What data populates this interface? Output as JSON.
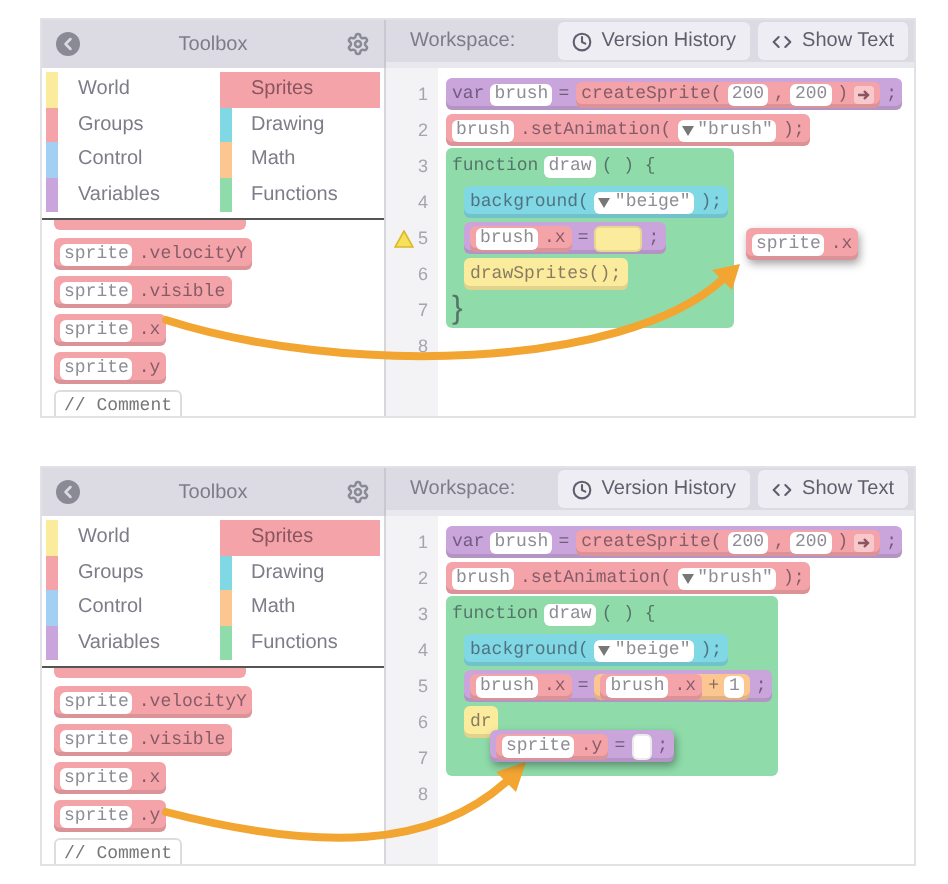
{
  "panels": [
    {
      "toolbox": {
        "title": "Toolbox",
        "categories": [
          {
            "label": "World",
            "color": "#fbeb9c",
            "selected": false
          },
          {
            "label": "Sprites",
            "color": "#f4a4a9",
            "selected": true
          },
          {
            "label": "Groups",
            "color": "#f4a4a9",
            "selected": false
          },
          {
            "label": "Drawing",
            "color": "#7fd8e4",
            "selected": false
          },
          {
            "label": "Control",
            "color": "#a3cff2",
            "selected": false
          },
          {
            "label": "Math",
            "color": "#fbc690",
            "selected": false
          },
          {
            "label": "Variables",
            "color": "#c9a5dc",
            "selected": false
          },
          {
            "label": "Functions",
            "color": "#8fdcaa",
            "selected": false
          }
        ],
        "palette": [
          {
            "kind": "block",
            "color": "#f4a4a9",
            "parts": [
              {
                "kind": "slot",
                "text": "sprite"
              },
              {
                "kind": "text",
                "text": ".velocityY"
              }
            ]
          },
          {
            "kind": "block",
            "color": "#f4a4a9",
            "parts": [
              {
                "kind": "slot",
                "text": "sprite"
              },
              {
                "kind": "text",
                "text": ".visible"
              }
            ]
          },
          {
            "kind": "block",
            "color": "#f4a4a9",
            "parts": [
              {
                "kind": "slot",
                "text": "sprite"
              },
              {
                "kind": "text",
                "text": ".x"
              }
            ]
          },
          {
            "kind": "block",
            "color": "#f4a4a9",
            "parts": [
              {
                "kind": "slot",
                "text": "sprite"
              },
              {
                "kind": "text",
                "text": ".y"
              }
            ]
          },
          {
            "kind": "comment",
            "text": "// Comment"
          }
        ]
      },
      "workspace": {
        "title": "Workspace:",
        "buttons": [
          {
            "label": "Version History",
            "kind": "history"
          },
          {
            "label": "Show Text",
            "kind": "code"
          }
        ],
        "line_numbers": [
          {
            "label": "1",
            "warning": false
          },
          {
            "label": "2",
            "warning": false
          },
          {
            "label": "3",
            "warning": false
          },
          {
            "label": "4",
            "warning": false
          },
          {
            "label": "5",
            "warning": true
          },
          {
            "label": "6",
            "warning": false
          },
          {
            "label": "7",
            "warning": false
          },
          {
            "label": "8",
            "warning": false
          }
        ],
        "program": [
          {
            "kind": "block",
            "color": "#c9a5dc",
            "parts": [
              {
                "kind": "text",
                "text": "var"
              },
              {
                "kind": "slot",
                "text": "brush"
              },
              {
                "kind": "text",
                "text": "="
              },
              {
                "kind": "block",
                "color": "#f4a4a9",
                "parts": [
                  {
                    "kind": "text",
                    "text": "createSprite("
                  },
                  {
                    "kind": "slot",
                    "text": "200"
                  },
                  {
                    "kind": "text",
                    "text": ","
                  },
                  {
                    "kind": "slot",
                    "text": "200"
                  },
                  {
                    "kind": "text",
                    "text": ")"
                  },
                  {
                    "kind": "expand"
                  }
                ]
              },
              {
                "kind": "text",
                "text": ";"
              }
            ]
          },
          {
            "kind": "block",
            "color": "#f4a4a9",
            "parts": [
              {
                "kind": "slot",
                "text": "brush"
              },
              {
                "kind": "text",
                "text": ".setAnimation("
              },
              {
                "kind": "dropdown",
                "text": "\"brush\""
              },
              {
                "kind": "text",
                "text": ");"
              }
            ]
          },
          {
            "kind": "function",
            "color": "#8fdcaa",
            "parts": [
              {
                "kind": "text",
                "text": "function"
              },
              {
                "kind": "slot",
                "text": "draw"
              },
              {
                "kind": "text",
                "text": "( ) {"
              }
            ],
            "end": "}",
            "children": [
              {
                "kind": "block",
                "color": "#7fd8e4",
                "parts": [
                  {
                    "kind": "text",
                    "text": "background("
                  },
                  {
                    "kind": "dropdown",
                    "text": "\"beige\""
                  },
                  {
                    "kind": "text",
                    "text": ");"
                  }
                ]
              },
              {
                "kind": "block",
                "color": "#c9a5dc",
                "parts": [
                  {
                    "kind": "block",
                    "color": "#f4a4a9",
                    "parts": [
                      {
                        "kind": "slot",
                        "text": "brush"
                      },
                      {
                        "kind": "text",
                        "text": ".x"
                      }
                    ]
                  },
                  {
                    "kind": "text",
                    "text": "="
                  },
                  {
                    "kind": "hole",
                    "color": "#fbeb9c"
                  },
                  {
                    "kind": "text",
                    "text": ";"
                  }
                ]
              },
              {
                "kind": "block",
                "color": "#fbeb9c",
                "parts": [
                  {
                    "kind": "text",
                    "text": "drawSprites();"
                  }
                ]
              }
            ]
          }
        ],
        "dragged": {
          "kind": "block",
          "color": "#f4a4a9",
          "parts": [
            {
              "kind": "slot",
              "text": "sprite"
            },
            {
              "kind": "text",
              "text": ".x"
            }
          ]
        }
      }
    },
    {
      "toolbox": {
        "title": "Toolbox",
        "categories": [
          {
            "label": "World",
            "color": "#fbeb9c",
            "selected": false
          },
          {
            "label": "Sprites",
            "color": "#f4a4a9",
            "selected": true
          },
          {
            "label": "Groups",
            "color": "#f4a4a9",
            "selected": false
          },
          {
            "label": "Drawing",
            "color": "#7fd8e4",
            "selected": false
          },
          {
            "label": "Control",
            "color": "#a3cff2",
            "selected": false
          },
          {
            "label": "Math",
            "color": "#fbc690",
            "selected": false
          },
          {
            "label": "Variables",
            "color": "#c9a5dc",
            "selected": false
          },
          {
            "label": "Functions",
            "color": "#8fdcaa",
            "selected": false
          }
        ],
        "palette": [
          {
            "kind": "block",
            "color": "#f4a4a9",
            "parts": [
              {
                "kind": "slot",
                "text": "sprite"
              },
              {
                "kind": "text",
                "text": ".velocityY"
              }
            ]
          },
          {
            "kind": "block",
            "color": "#f4a4a9",
            "parts": [
              {
                "kind": "slot",
                "text": "sprite"
              },
              {
                "kind": "text",
                "text": ".visible"
              }
            ]
          },
          {
            "kind": "block",
            "color": "#f4a4a9",
            "parts": [
              {
                "kind": "slot",
                "text": "sprite"
              },
              {
                "kind": "text",
                "text": ".x"
              }
            ]
          },
          {
            "kind": "block",
            "color": "#f4a4a9",
            "parts": [
              {
                "kind": "slot",
                "text": "sprite"
              },
              {
                "kind": "text",
                "text": ".y"
              }
            ]
          },
          {
            "kind": "comment",
            "text": "// Comment"
          }
        ]
      },
      "workspace": {
        "title": "Workspace:",
        "buttons": [
          {
            "label": "Version History",
            "kind": "history"
          },
          {
            "label": "Show Text",
            "kind": "code"
          }
        ],
        "line_numbers": [
          {
            "label": "1",
            "warning": false
          },
          {
            "label": "2",
            "warning": false
          },
          {
            "label": "3",
            "warning": false
          },
          {
            "label": "4",
            "warning": false
          },
          {
            "label": "5",
            "warning": false
          },
          {
            "label": "6",
            "warning": false
          },
          {
            "label": "7",
            "warning": false
          },
          {
            "label": "8",
            "warning": false
          }
        ],
        "program": [
          {
            "kind": "block",
            "color": "#c9a5dc",
            "parts": [
              {
                "kind": "text",
                "text": "var"
              },
              {
                "kind": "slot",
                "text": "brush"
              },
              {
                "kind": "text",
                "text": "="
              },
              {
                "kind": "block",
                "color": "#f4a4a9",
                "parts": [
                  {
                    "kind": "text",
                    "text": "createSprite("
                  },
                  {
                    "kind": "slot",
                    "text": "200"
                  },
                  {
                    "kind": "text",
                    "text": ","
                  },
                  {
                    "kind": "slot",
                    "text": "200"
                  },
                  {
                    "kind": "text",
                    "text": ")"
                  },
                  {
                    "kind": "expand"
                  }
                ]
              },
              {
                "kind": "text",
                "text": ";"
              }
            ]
          },
          {
            "kind": "block",
            "color": "#f4a4a9",
            "parts": [
              {
                "kind": "slot",
                "text": "brush"
              },
              {
                "kind": "text",
                "text": ".setAnimation("
              },
              {
                "kind": "dropdown",
                "text": "\"brush\""
              },
              {
                "kind": "text",
                "text": ");"
              }
            ]
          },
          {
            "kind": "function",
            "color": "#8fdcaa",
            "parts": [
              {
                "kind": "text",
                "text": "function"
              },
              {
                "kind": "slot",
                "text": "draw"
              },
              {
                "kind": "text",
                "text": "( ) {"
              }
            ],
            "children": [
              {
                "kind": "block",
                "color": "#7fd8e4",
                "parts": [
                  {
                    "kind": "text",
                    "text": "background("
                  },
                  {
                    "kind": "dropdown",
                    "text": "\"beige\""
                  },
                  {
                    "kind": "text",
                    "text": ");"
                  }
                ]
              },
              {
                "kind": "block",
                "color": "#c9a5dc",
                "parts": [
                  {
                    "kind": "block",
                    "color": "#f4a4a9",
                    "parts": [
                      {
                        "kind": "slot",
                        "text": "brush"
                      },
                      {
                        "kind": "text",
                        "text": ".x"
                      }
                    ]
                  },
                  {
                    "kind": "text",
                    "text": "="
                  },
                  {
                    "kind": "block",
                    "color": "#fbc690",
                    "parts": [
                      {
                        "kind": "block",
                        "color": "#f4a4a9",
                        "parts": [
                          {
                            "kind": "slot",
                            "text": "brush"
                          },
                          {
                            "kind": "text",
                            "text": ".x"
                          }
                        ]
                      },
                      {
                        "kind": "text",
                        "text": "+"
                      },
                      {
                        "kind": "slot",
                        "text": "1"
                      }
                    ]
                  },
                  {
                    "kind": "text",
                    "text": ";"
                  }
                ]
              },
              {
                "kind": "block",
                "color": "#fbeb9c",
                "parts": [
                  {
                    "kind": "text",
                    "text": "dr"
                  }
                ]
              }
            ]
          }
        ],
        "dragged": {
          "kind": "block",
          "color": "#c9a5dc",
          "parts": [
            {
              "kind": "block",
              "color": "#f4a4a9",
              "parts": [
                {
                  "kind": "slot",
                  "text": "sprite"
                },
                {
                  "kind": "text",
                  "text": ".y"
                }
              ]
            },
            {
              "kind": "text",
              "text": "="
            },
            {
              "kind": "hole",
              "color": "#ffffff"
            },
            {
              "kind": "text",
              "text": ";"
            }
          ]
        }
      }
    }
  ]
}
